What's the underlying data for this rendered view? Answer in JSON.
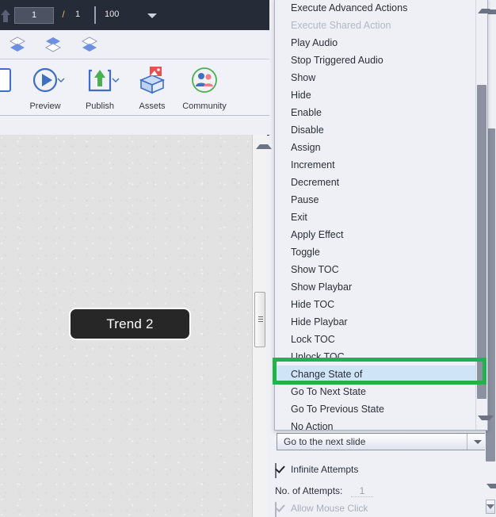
{
  "topbar": {
    "home_icon": "home-arrow-icon",
    "page_current": "1",
    "separator": "/",
    "page_total": "1",
    "zoom_value": "100",
    "zoom_caret_icon": "chevron-down-icon"
  },
  "layer_toolbar": {
    "items": [
      {
        "name": "bring-to-front",
        "icon": "layers-front-icon"
      },
      {
        "name": "send-backward",
        "icon": "layers-middle-icon"
      },
      {
        "name": "send-to-back",
        "icon": "layers-back-icon"
      }
    ]
  },
  "ribbon": {
    "items": [
      {
        "label": "",
        "icon": "slide-icon"
      },
      {
        "label": "Preview",
        "icon": "play-circle-icon"
      },
      {
        "label": "Publish",
        "icon": "publish-upload-icon"
      },
      {
        "label": "Assets",
        "icon": "assets-box-icon"
      },
      {
        "label": "Community",
        "icon": "community-people-icon"
      }
    ]
  },
  "canvas": {
    "button_label": "Trend 2"
  },
  "canvas_scrollbar": {
    "up_icon": "scroll-up-arrow-icon",
    "thumb": "scroll-thumb"
  },
  "dropdown": {
    "name": "action-dropdown-list",
    "scroll_up_icon": "scroll-up-arrow-icon",
    "scroll_down_icon": "scroll-down-arrow-icon",
    "selected": "Change State of",
    "items": [
      {
        "label": "Execute Advanced Actions",
        "disabled": false,
        "selected": false
      },
      {
        "label": "Execute Shared Action",
        "disabled": true,
        "selected": false
      },
      {
        "label": "Play Audio",
        "disabled": false,
        "selected": false
      },
      {
        "label": "Stop Triggered Audio",
        "disabled": false,
        "selected": false
      },
      {
        "label": "Show",
        "disabled": false,
        "selected": false
      },
      {
        "label": "Hide",
        "disabled": false,
        "selected": false
      },
      {
        "label": "Enable",
        "disabled": false,
        "selected": false
      },
      {
        "label": "Disable",
        "disabled": false,
        "selected": false
      },
      {
        "label": "Assign",
        "disabled": false,
        "selected": false
      },
      {
        "label": "Increment",
        "disabled": false,
        "selected": false
      },
      {
        "label": "Decrement",
        "disabled": false,
        "selected": false
      },
      {
        "label": "Pause",
        "disabled": false,
        "selected": false
      },
      {
        "label": "Exit",
        "disabled": false,
        "selected": false
      },
      {
        "label": "Apply Effect",
        "disabled": false,
        "selected": false
      },
      {
        "label": "Toggle",
        "disabled": false,
        "selected": false
      },
      {
        "label": "Show TOC",
        "disabled": false,
        "selected": false
      },
      {
        "label": "Show Playbar",
        "disabled": false,
        "selected": false
      },
      {
        "label": "Hide TOC",
        "disabled": false,
        "selected": false
      },
      {
        "label": "Hide Playbar",
        "disabled": false,
        "selected": false
      },
      {
        "label": "Lock TOC",
        "disabled": false,
        "selected": false
      },
      {
        "label": "Unlock TOC",
        "disabled": false,
        "selected": false
      },
      {
        "label": "Change State of",
        "disabled": false,
        "selected": true
      },
      {
        "label": "Go To Next State",
        "disabled": false,
        "selected": false
      },
      {
        "label": "Go To Previous State",
        "disabled": false,
        "selected": false
      },
      {
        "label": "No Action",
        "disabled": false,
        "selected": false
      }
    ]
  },
  "properties": {
    "action_combo_value": "Go to the next slide",
    "action_combo_caret_icon": "chevron-down-icon",
    "infinite_attempts_label": "Infinite Attempts",
    "infinite_attempts_checked": true,
    "attempts_label": "No. of Attempts:",
    "attempts_value": "1",
    "allow_mouse_click_label": "Allow Mouse Click",
    "allow_mouse_click_checked": true,
    "allow_mouse_click_disabled": true
  },
  "panel_scrollbar": {
    "up_icon": "scroll-up-arrow-icon",
    "down_icon": "scroll-down-arrow-icon"
  },
  "annotation": {
    "type": "green-rectangle-highlight",
    "color": "#22b14c",
    "target": "Change State of"
  }
}
